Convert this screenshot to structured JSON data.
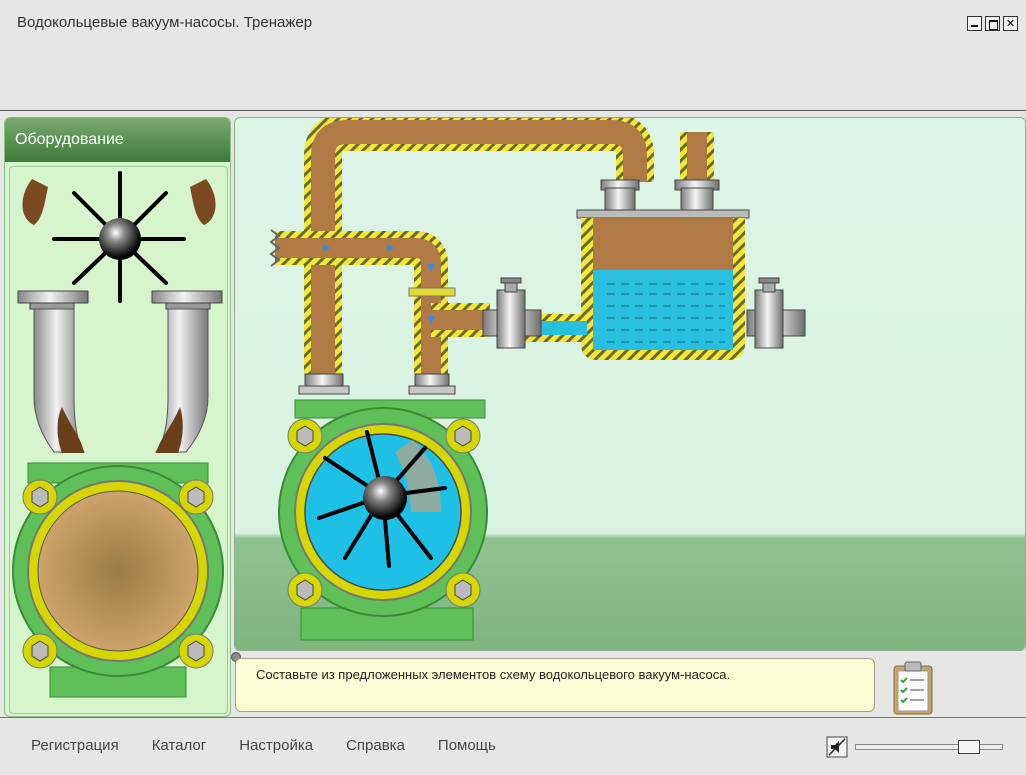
{
  "window": {
    "title": "Водокольцевые вакуум-насосы. Тренажер",
    "controls": [
      "minimize",
      "maximize",
      "close"
    ]
  },
  "left_panel": {
    "header": "Оборудование",
    "items": [
      "impeller",
      "elbow-pipe-left",
      "elbow-pipe-right",
      "pump-housing"
    ]
  },
  "scene": {
    "parts": [
      "inlet-pipe",
      "discharge-pipe",
      "separator-tank",
      "inlet-valve",
      "tank-outlet-valve",
      "pump-assembly"
    ],
    "colors": {
      "pipe_fill": "#b07a45",
      "pipe_outline": "#f0e040",
      "water": "#29c0e0",
      "pump_body": "#5fc05a",
      "flange": "#d6d600"
    }
  },
  "info": {
    "message": "Составьте из предложенных элементов схему водокольцевого вакуум-насоса."
  },
  "bottom_menu": {
    "items": [
      "Регистрация",
      "Каталог",
      "Настройка",
      "Справка",
      "Помощь"
    ]
  },
  "volume": {
    "level": 0.77
  }
}
